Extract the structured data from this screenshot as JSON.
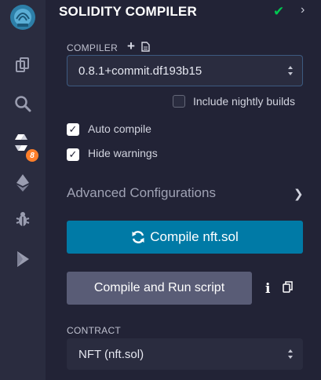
{
  "header": {
    "title": "SOLIDITY COMPILER",
    "status_icon": "check-icon",
    "chevron_icon": "chevron-right-icon",
    "status_color": "#00c851"
  },
  "rail": {
    "items": [
      {
        "name": "remix-logo",
        "icon": "remix-logo-icon"
      },
      {
        "name": "file-explorer",
        "icon": "files-icon"
      },
      {
        "name": "search",
        "icon": "search-icon"
      },
      {
        "name": "solidity-compiler",
        "icon": "solidity-icon",
        "badge": "8"
      },
      {
        "name": "deploy-run",
        "icon": "ethereum-icon"
      },
      {
        "name": "debugger",
        "icon": "bug-icon"
      },
      {
        "name": "run-script",
        "icon": "play-icon"
      }
    ]
  },
  "compiler": {
    "label": "COMPILER",
    "add_icon": "plus-icon",
    "file_icon": "file-icon",
    "selected_version": "0.8.1+commit.df193b15",
    "include_nightly_label": "Include nightly builds",
    "include_nightly_checked": false
  },
  "options": {
    "auto_compile_label": "Auto compile",
    "auto_compile_checked": true,
    "hide_warnings_label": "Hide warnings",
    "hide_warnings_checked": true
  },
  "advanced": {
    "title": "Advanced Configurations"
  },
  "actions": {
    "compile_label": "Compile nft.sol",
    "compile_icon": "refresh-icon",
    "compile_color": "#007aa6",
    "run_script_label": "Compile and Run script",
    "info_icon": "info-icon",
    "copy_icon": "copy-icon"
  },
  "contract": {
    "label": "CONTRACT",
    "selected": "NFT (nft.sol)"
  }
}
